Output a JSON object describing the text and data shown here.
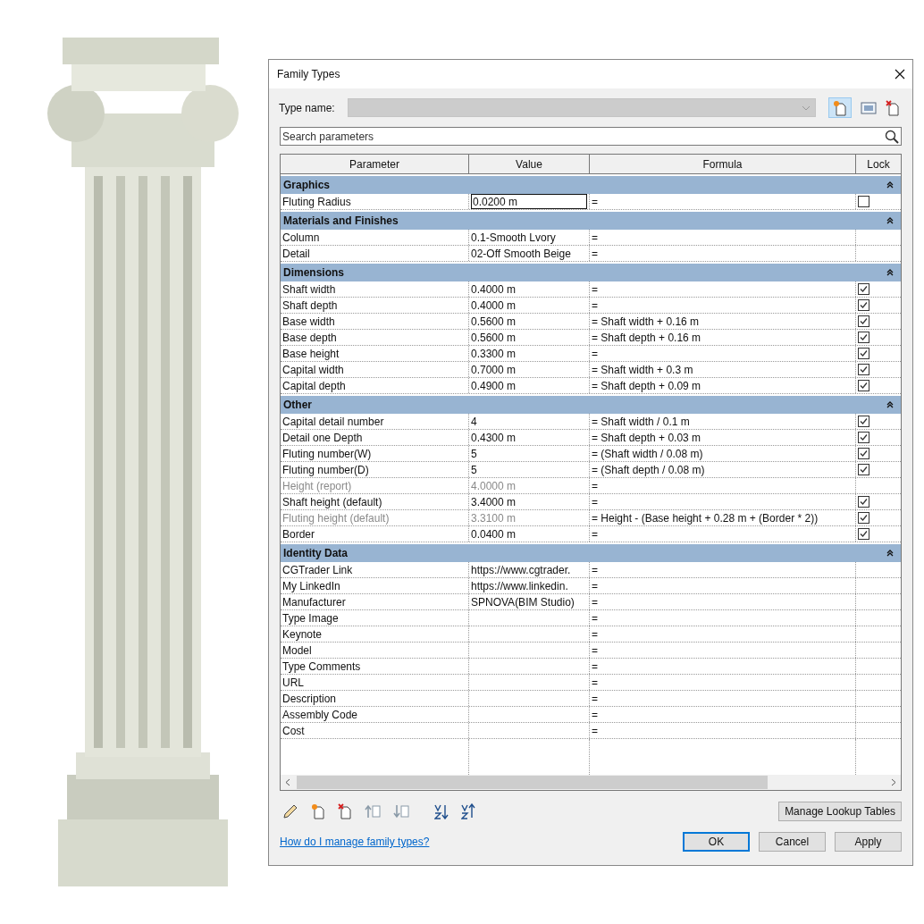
{
  "dialog": {
    "title": "Family Types",
    "type_name": {
      "label": "Type name:",
      "disabled": true
    },
    "search": {
      "placeholder": "Search parameters"
    },
    "table": {
      "columns": [
        "Parameter",
        "Value",
        "Formula",
        "Lock"
      ],
      "groups": [
        {
          "name": "Graphics",
          "expanded": true,
          "rows": [
            {
              "parameter": "Fluting Radius",
              "value": "0.0200 m",
              "formula": "=",
              "locked": false,
              "disabled": false,
              "editing": true
            }
          ]
        },
        {
          "name": "Materials and Finishes",
          "expanded": true,
          "rows": [
            {
              "parameter": "Column",
              "value": "0.1-Smooth Lvory",
              "formula": "=",
              "disabled": false,
              "editing": false
            },
            {
              "parameter": "Detail",
              "value": "02-Off Smooth Beige",
              "formula": "=",
              "disabled": false,
              "editing": false
            }
          ]
        },
        {
          "name": "Dimensions",
          "expanded": true,
          "rows": [
            {
              "parameter": "Shaft width",
              "value": "0.4000 m",
              "formula": "=",
              "locked": true,
              "disabled": false,
              "editing": false
            },
            {
              "parameter": "Shaft depth",
              "value": "0.4000 m",
              "formula": "=",
              "locked": true,
              "disabled": false,
              "editing": false
            },
            {
              "parameter": "Base width",
              "value": "0.5600 m",
              "formula": "= Shaft width + 0.16 m",
              "locked": true,
              "disabled": false,
              "editing": false
            },
            {
              "parameter": "Base depth",
              "value": "0.5600 m",
              "formula": "= Shaft depth + 0.16 m",
              "locked": true,
              "disabled": false,
              "editing": false
            },
            {
              "parameter": "Base height",
              "value": "0.3300 m",
              "formula": "=",
              "locked": true,
              "disabled": false,
              "editing": false
            },
            {
              "parameter": "Capital width",
              "value": "0.7000 m",
              "formula": "= Shaft width + 0.3 m",
              "locked": true,
              "disabled": false,
              "editing": false
            },
            {
              "parameter": "Capital depth",
              "value": "0.4900 m",
              "formula": "= Shaft depth + 0.09 m",
              "locked": true,
              "disabled": false,
              "editing": false
            }
          ]
        },
        {
          "name": "Other",
          "expanded": true,
          "rows": [
            {
              "parameter": "Capital detail number",
              "value": "4",
              "formula": "= Shaft width / 0.1 m",
              "locked": true,
              "disabled": false,
              "editing": false
            },
            {
              "parameter": "Detail one Depth",
              "value": "0.4300 m",
              "formula": "= Shaft depth + 0.03 m",
              "locked": true,
              "disabled": false,
              "editing": false
            },
            {
              "parameter": "Fluting number(W)",
              "value": "5",
              "formula": "= (Shaft width / 0.08 m)",
              "locked": true,
              "disabled": false,
              "editing": false
            },
            {
              "parameter": "Fluting number(D)",
              "value": "5",
              "formula": "= (Shaft depth / 0.08 m)",
              "locked": true,
              "disabled": false,
              "editing": false
            },
            {
              "parameter": "Height (report)",
              "value": "4.0000 m",
              "formula": "=",
              "disabled": true,
              "editing": false
            },
            {
              "parameter": "Shaft height (default)",
              "value": "3.4000 m",
              "formula": "=",
              "locked": true,
              "disabled": false,
              "editing": false
            },
            {
              "parameter": "Fluting height (default)",
              "value": "3.3100 m",
              "formula": "= Height - (Base height + 0.28 m + (Border * 2))",
              "locked": true,
              "disabled": true,
              "editing": false
            },
            {
              "parameter": "Border",
              "value": "0.0400 m",
              "formula": "=",
              "locked": true,
              "disabled": false,
              "editing": false
            }
          ]
        },
        {
          "name": "Identity Data",
          "expanded": true,
          "rows": [
            {
              "parameter": "CGTrader Link",
              "value": "https://www.cgtrader.",
              "formula": "=",
              "disabled": false,
              "editing": false
            },
            {
              "parameter": "My LinkedIn",
              "value": "https://www.linkedin.",
              "formula": "=",
              "disabled": false,
              "editing": false
            },
            {
              "parameter": "Manufacturer",
              "value": "SPNOVA(BIM Studio)",
              "formula": "=",
              "disabled": false,
              "editing": false
            },
            {
              "parameter": "Type Image",
              "formula": "=",
              "disabled": false,
              "editing": false
            },
            {
              "parameter": "Keynote",
              "formula": "=",
              "disabled": false,
              "editing": false
            },
            {
              "parameter": "Model",
              "formula": "=",
              "disabled": false,
              "editing": false
            },
            {
              "parameter": "Type Comments",
              "formula": "=",
              "disabled": false,
              "editing": false
            },
            {
              "parameter": "URL",
              "formula": "=",
              "disabled": false,
              "editing": false
            },
            {
              "parameter": "Description",
              "formula": "=",
              "disabled": false,
              "editing": false
            },
            {
              "parameter": "Assembly Code",
              "formula": "=",
              "disabled": false,
              "editing": false
            },
            {
              "parameter": "Cost",
              "formula": "=",
              "disabled": false,
              "editing": false
            }
          ]
        }
      ]
    },
    "lookup_button": "Manage Lookup Tables",
    "help_link": "How do I manage family types?",
    "buttons": [
      {
        "label": "OK",
        "default": true
      },
      {
        "label": "Cancel",
        "default": false
      },
      {
        "label": "Apply",
        "default": false
      }
    ]
  }
}
